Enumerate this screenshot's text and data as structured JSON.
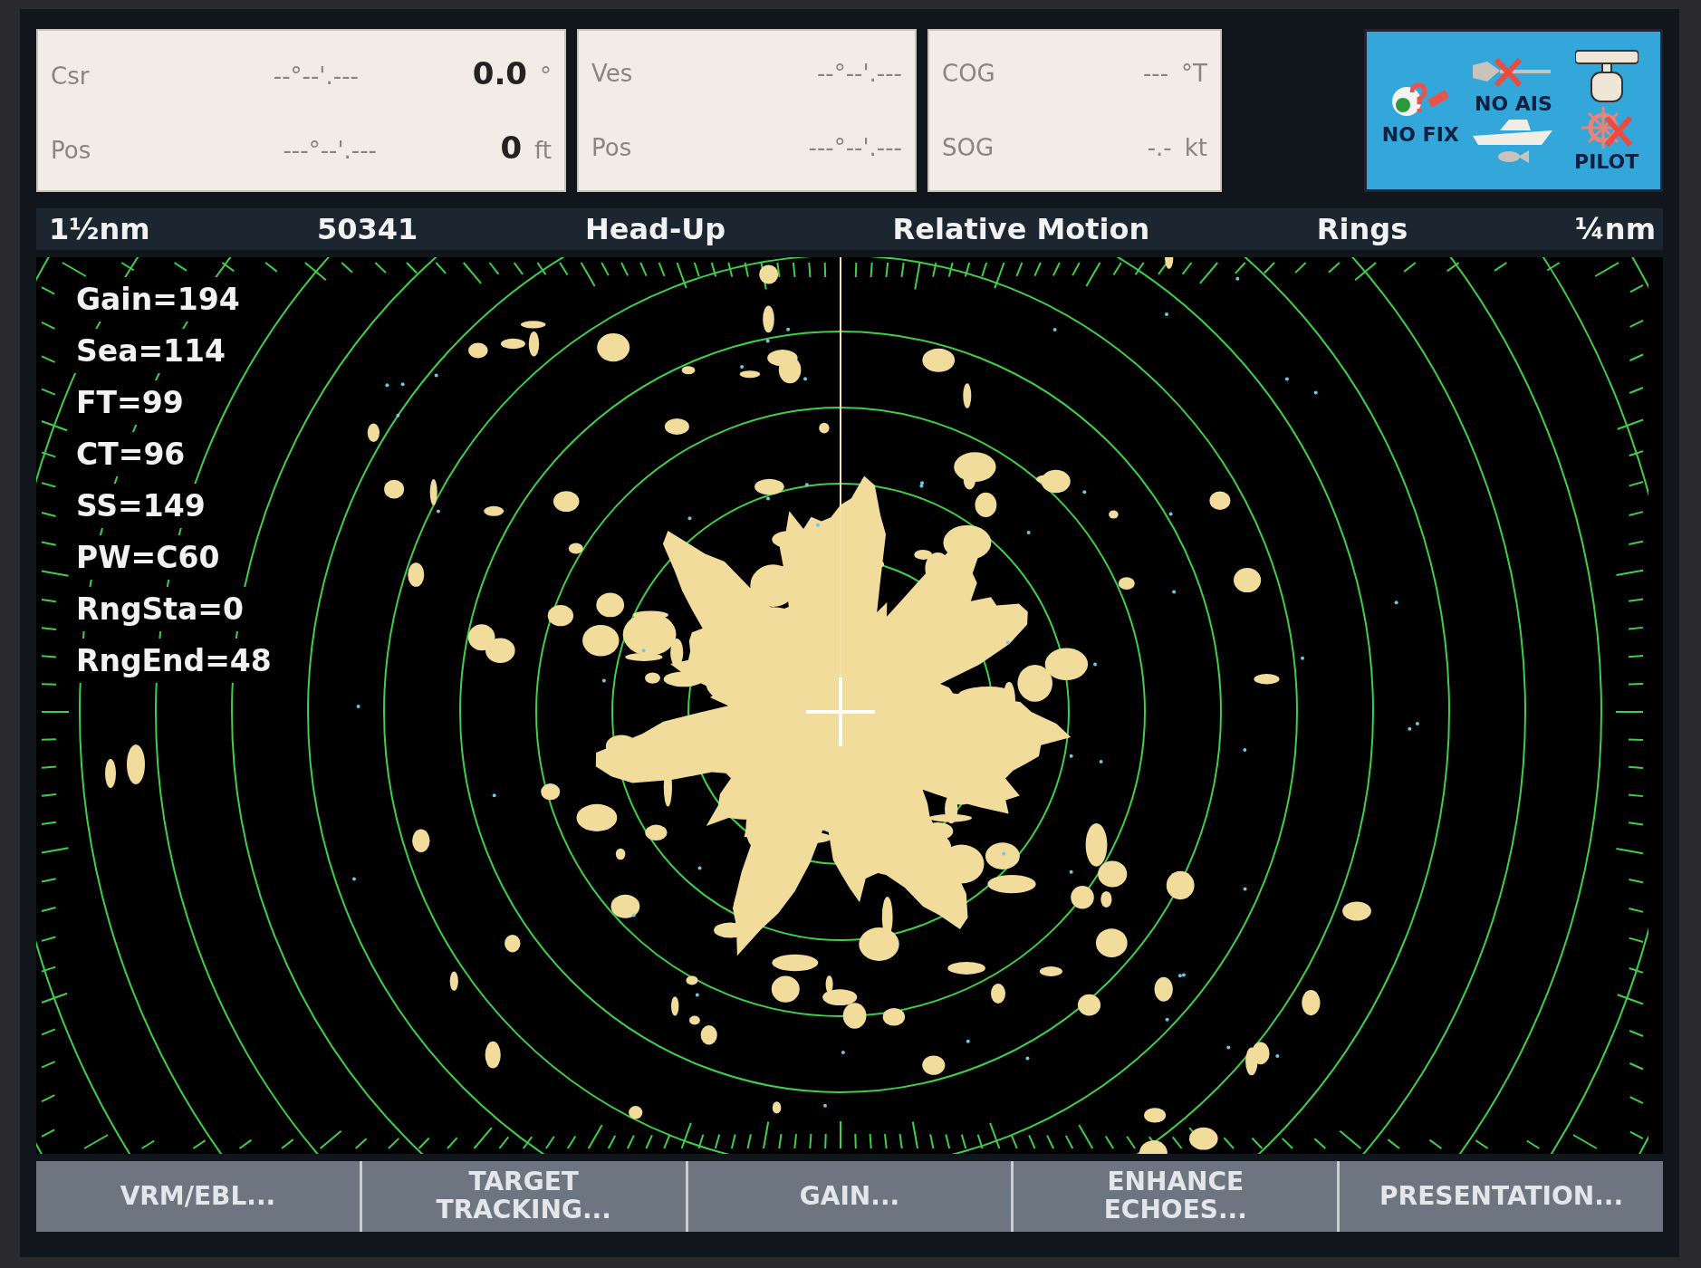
{
  "position_panel": {
    "rows": [
      {
        "label": "Csr",
        "coordinate": "--°--'.---",
        "value": "0.0",
        "unit": "°"
      },
      {
        "label": "Pos",
        "coordinate": "---°--'.---",
        "value": "0",
        "unit": "ft"
      }
    ]
  },
  "vessel_panel": {
    "rows": [
      {
        "label": "Ves",
        "coordinate": "--°--'.---"
      },
      {
        "label": "Pos",
        "coordinate": "---°--'.---"
      }
    ]
  },
  "nav_panel": {
    "rows": [
      {
        "label": "COG",
        "value": "---",
        "unit": "°T"
      },
      {
        "label": "SOG",
        "value": "-.-",
        "unit": "kt"
      }
    ]
  },
  "status_panel": {
    "fix_label": "NO FIX",
    "ais_label": "NO AIS",
    "pilot_label": "PILOT"
  },
  "header": [
    "1½nm",
    "50341",
    "Head-Up",
    "Relative Motion",
    "Rings",
    "¼nm"
  ],
  "readouts": [
    "Gain=194",
    "Sea=114",
    "FT=99",
    "CT=96",
    "SS=149",
    "PW=C60",
    "RngSta=0",
    "RngEnd=48"
  ],
  "softkeys": [
    {
      "lines": [
        "VRM/EBL..."
      ]
    },
    {
      "lines": [
        "TARGET",
        "TRACKING..."
      ]
    },
    {
      "lines": [
        "GAIN..."
      ]
    },
    {
      "lines": [
        "ENHANCE",
        "ECHOES..."
      ]
    },
    {
      "lines": [
        "PRESENTATION..."
      ]
    }
  ]
}
